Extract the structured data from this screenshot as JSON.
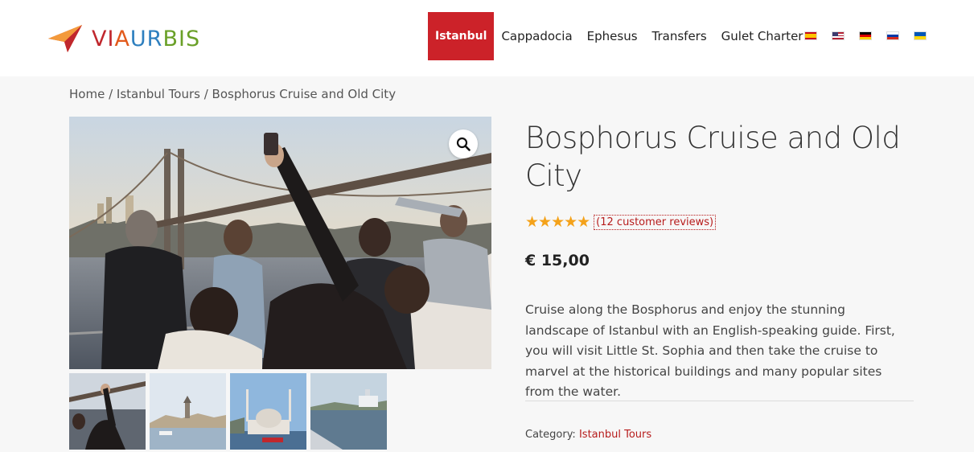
{
  "brand": {
    "logo_text_parts": [
      "VI",
      "A",
      "UR",
      "BIS"
    ],
    "colors": {
      "red": "#c0272d",
      "orange": "#e25a1c",
      "blue": "#2e7fbf",
      "green": "#6aa028",
      "accent": "#cc2229"
    }
  },
  "nav": {
    "items": [
      {
        "label": "Istanbul",
        "active": true
      },
      {
        "label": "Cappadocia",
        "active": false
      },
      {
        "label": "Ephesus",
        "active": false
      },
      {
        "label": "Transfers",
        "active": false
      },
      {
        "label": "Gulet Charter",
        "active": false
      }
    ],
    "flags": [
      "spain-flag-icon",
      "usa-flag-icon",
      "germany-flag-icon",
      "russia-flag-icon",
      "ukraine-flag-icon"
    ]
  },
  "breadcrumb": {
    "home": "Home",
    "sep1": " / ",
    "category": "Istanbul Tours",
    "sep2": " / ",
    "current": "Bosphorus Cruise and Old City"
  },
  "product": {
    "title": "Bosphorus Cruise and Old City",
    "stars": "★★★★★",
    "rating_fraction": 1.0,
    "reviews_label": "(12 customer reviews)",
    "price": "€ 15,00",
    "description": "Cruise along the Bosphorus and enjoy the stunning landscape of Istanbul with an English-speaking guide. First, you will visit Little St. Sophia and then take the cruise to marvel at the historical buildings and many popular sites from the water.",
    "category_label": "Category:",
    "category_link": "Istanbul Tours"
  },
  "gallery": {
    "zoom_icon": "magnifier-icon",
    "thumbnails": [
      "thumbnail-group-photo",
      "thumbnail-galata-view",
      "thumbnail-ortakoy-mosque",
      "thumbnail-ferry"
    ]
  }
}
